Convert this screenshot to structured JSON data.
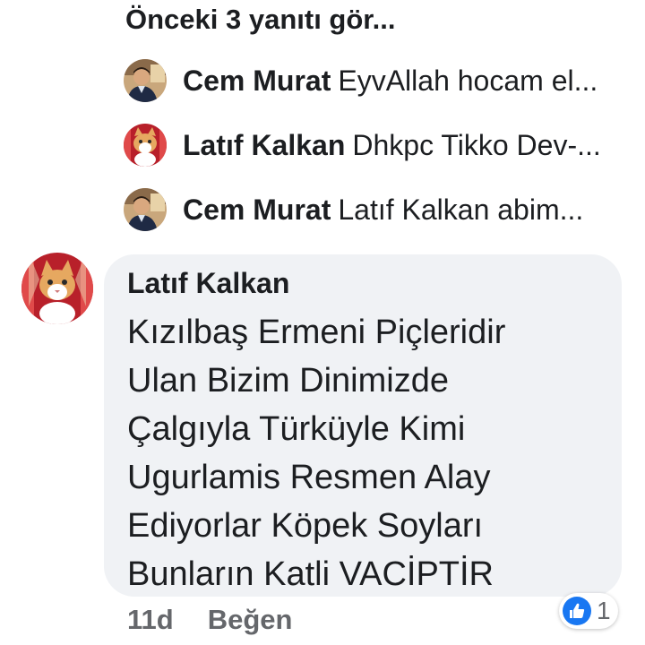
{
  "thread": {
    "previous_replies_label": "Önceki 3 yanıtı gör..."
  },
  "replies": [
    {
      "author": "Cem Murat",
      "snippet": "EyvAllah hocam el...",
      "avatar": "man-portrait-avatar"
    },
    {
      "author": "Latıf Kalkan",
      "snippet": "Dhkpc Tikko Dev-...",
      "avatar": "cat-avatar"
    },
    {
      "author": "Cem Murat",
      "snippet": "Latıf Kalkan abim...",
      "avatar": "man-portrait-avatar"
    }
  ],
  "comment": {
    "author": "Latıf Kalkan",
    "avatar": "cat-avatar",
    "lines": [
      "Kızılbaş Ermeni Piçleridir",
      "Ulan Bizim Dinimizde",
      "Çalgıyla Türküyle Kimi",
      "Ugurlamis Resmen Alay",
      "Ediyorlar Köpek Soyları",
      "Bunların Katli VACİPTİR"
    ],
    "time": "11d",
    "like_label": "Beğen",
    "reaction_icon": "thumbs-up-icon",
    "reaction_count": "1"
  },
  "colors": {
    "bubble": "#f0f2f5",
    "meta_text": "#65676b",
    "like_blue": "#1877f2"
  }
}
